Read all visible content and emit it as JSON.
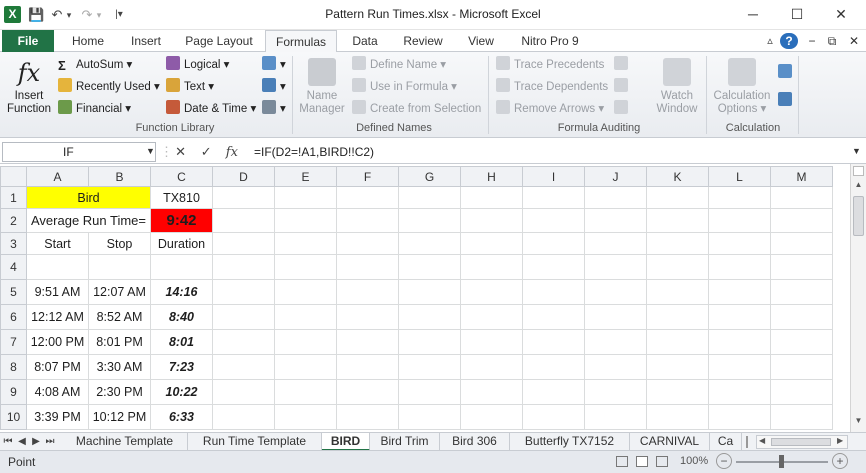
{
  "window": {
    "title": "Pattern Run Times.xlsx  -  Microsoft Excel",
    "logo": "X",
    "minimize": "─",
    "maximize": "☐",
    "close": "✕"
  },
  "quick_access": {
    "save": "💾",
    "undo": "↶",
    "undo_arrow": "▾",
    "redo": "↷",
    "redo_arrow": "▾",
    "customize": "|▾"
  },
  "ribbon_tabs": {
    "file": "File",
    "items": [
      "Home",
      "Insert",
      "Page Layout",
      "Formulas",
      "Data",
      "Review",
      "View",
      "Nitro Pro 9"
    ],
    "active": "Formulas"
  },
  "ribbon_right": {
    "minimize": "▵",
    "help": "?",
    "restore": "⧉",
    "close": "✕"
  },
  "ribbon": {
    "function_library": {
      "label": "Function Library",
      "insert_function": [
        "Insert",
        "Function"
      ],
      "items": [
        "AutoSum ▾",
        "Recently Used ▾",
        "Financial ▾",
        "Logical ▾",
        "Text ▾",
        "Date & Time ▾"
      ]
    },
    "defined_names": {
      "label": "Defined Names",
      "name_manager": [
        "Name",
        "Manager"
      ],
      "items": [
        "Define Name ▾",
        "Use in Formula ▾",
        "Create from Selection"
      ]
    },
    "formula_auditing": {
      "label": "Formula Auditing",
      "items": [
        "Trace Precedents",
        "Trace Dependents",
        "Remove Arrows ▾"
      ],
      "watch_window": [
        "Watch",
        "Window"
      ]
    },
    "calculation": {
      "label": "Calculation",
      "options": [
        "Calculation",
        "Options ▾"
      ]
    }
  },
  "formula_bar": {
    "name_box": "IF",
    "formula": "=IF(D2=!A1,BIRD!!C2)",
    "cancel": "✕",
    "enter": "✓",
    "fx": "fx"
  },
  "sheet": {
    "columns": [
      "A",
      "B",
      "C",
      "D",
      "E",
      "F",
      "G",
      "H",
      "I",
      "J",
      "K",
      "L",
      "M"
    ],
    "rows": [
      "1",
      "2",
      "3",
      "4",
      "5",
      "6",
      "7",
      "8",
      "9",
      "10"
    ],
    "cells": {
      "A1": "Bird",
      "C1": "TX810",
      "A2": "Average Run Time=",
      "C2": "9:42",
      "A3": "Start",
      "B3": "Stop",
      "C3": "Duration",
      "A5": "9:51 AM",
      "B5": "12:07 AM",
      "C5": "14:16",
      "A6": "12:12 AM",
      "B6": "8:52 AM",
      "C6": "8:40",
      "A7": "12:00 PM",
      "B7": "8:01 PM",
      "C7": "8:01",
      "A8": "8:07 PM",
      "B8": "3:30 AM",
      "C8": "7:23",
      "A9": "4:08 AM",
      "B9": "2:30 PM",
      "C9": "10:22",
      "A10": "3:39 PM",
      "B10": "10:12 PM",
      "C10": "6:33"
    },
    "colors": {
      "bird_fill": "#ffff00",
      "average_fill": "#ff0000"
    }
  },
  "sheet_tabs": {
    "items": [
      "Machine Template",
      "Run Time Template",
      "BIRD",
      "Bird Trim",
      "Bird 306",
      "Butterfly TX7152",
      "CARNIVAL",
      "Ca"
    ],
    "active": "BIRD",
    "nav": [
      "⏮",
      "◀",
      "▶",
      "⏭"
    ]
  },
  "status_bar": {
    "mode": "Point",
    "zoom": "100%",
    "zoom_minus": "−",
    "zoom_plus": "+"
  },
  "accent": "#217346"
}
